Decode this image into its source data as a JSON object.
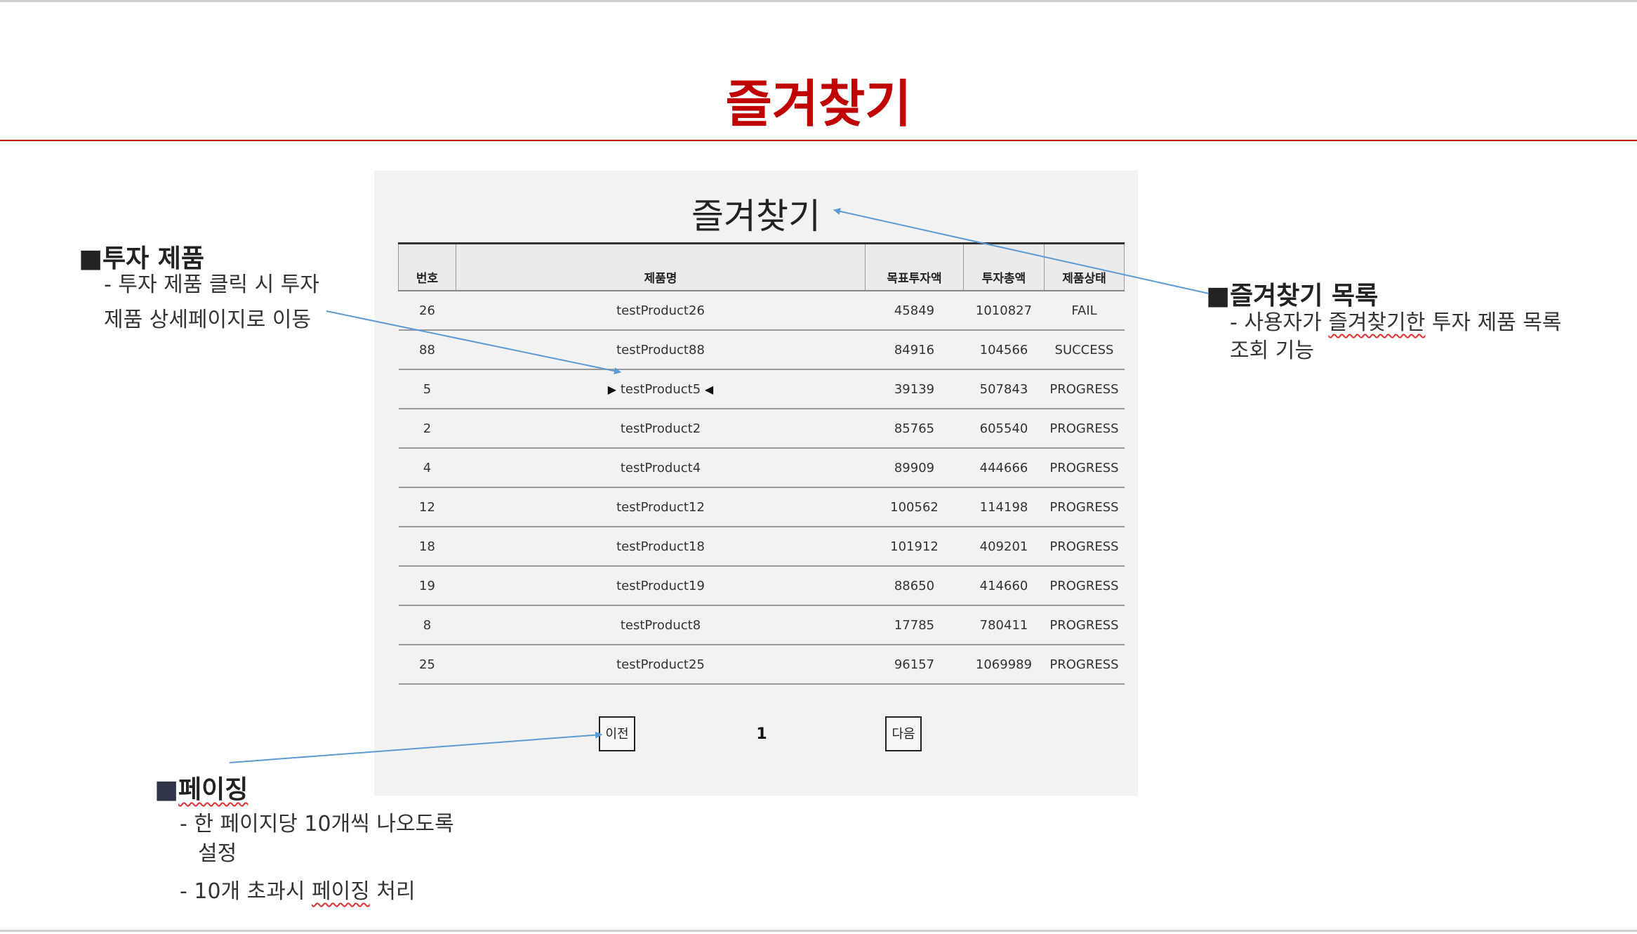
{
  "slide": {
    "title": "즐겨찾기"
  },
  "mockup": {
    "title": "즐겨찾기",
    "columns": [
      "번호",
      "제품명",
      "목표투자액",
      "투자총액",
      "제품상태"
    ],
    "rows": [
      [
        "26",
        "testProduct26",
        "45849",
        "1010827",
        "FAIL"
      ],
      [
        "88",
        "testProduct88",
        "84916",
        "104566",
        "SUCCESS"
      ],
      [
        "5",
        "testProduct5",
        "39139",
        "507843",
        "PROGRESS"
      ],
      [
        "2",
        "testProduct2",
        "85765",
        "605540",
        "PROGRESS"
      ],
      [
        "4",
        "testProduct4",
        "89909",
        "444666",
        "PROGRESS"
      ],
      [
        "12",
        "testProduct12",
        "100562",
        "114198",
        "PROGRESS"
      ],
      [
        "18",
        "testProduct18",
        "101912",
        "409201",
        "PROGRESS"
      ],
      [
        "19",
        "testProduct19",
        "88650",
        "414660",
        "PROGRESS"
      ],
      [
        "8",
        "testProduct8",
        "17785",
        "780411",
        "PROGRESS"
      ],
      [
        "25",
        "testProduct25",
        "96157",
        "1069989",
        "PROGRESS"
      ]
    ],
    "pager": {
      "prev_label": "이전",
      "current_page": "1",
      "next_label": "다음"
    }
  },
  "annotations": {
    "product": {
      "heading": "■투자 제품",
      "lines": [
        "- 투자 제품 클릭 시 투자",
        "제품 상세페이지로 이동"
      ]
    },
    "favorites": {
      "heading": "■즐겨찾기 목록",
      "line1_a": "- 사용자가 ",
      "line1_b": "즐겨찾기한",
      "line1_c": " 투자 제품 목록",
      "line2": "조회 기능"
    },
    "paging": {
      "heading_sq": "■",
      "heading": "페이징",
      "line1": "- 한 페이지당 10개씩 나오도록",
      "line2": "설정",
      "line3_a": "- 10개 초과시 ",
      "line3_b": "페이징",
      "line3_c": " 처리"
    }
  },
  "colors": {
    "title_red": "#c00000",
    "arrow_blue": "#5b9bd5"
  }
}
